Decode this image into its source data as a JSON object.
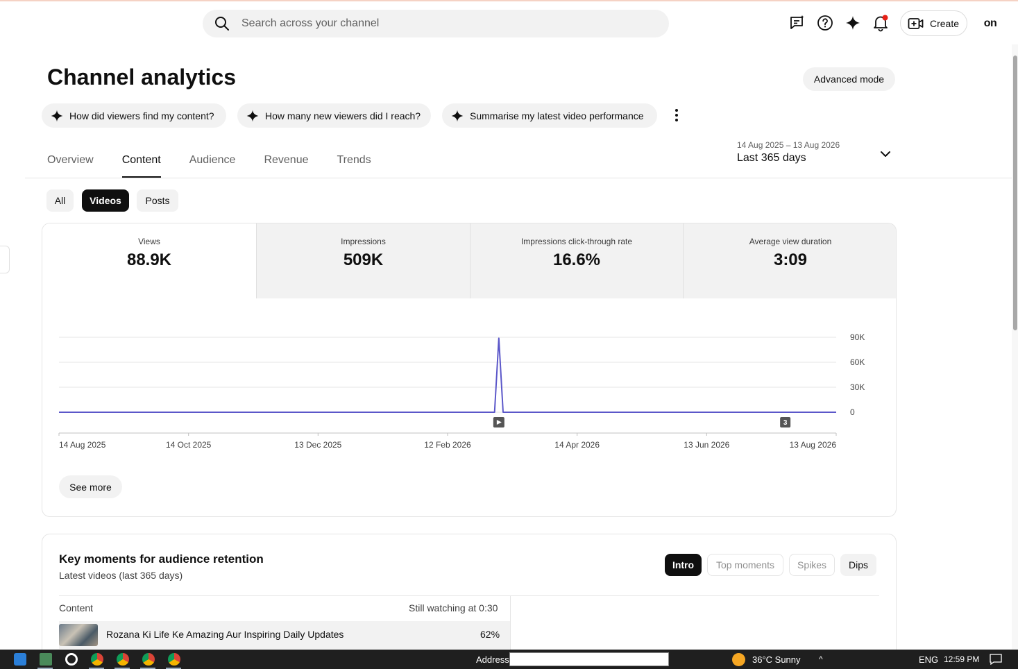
{
  "header": {
    "search_placeholder": "Search across your channel",
    "create_label": "Create",
    "avatar_text": "on",
    "icons": [
      "feedback-icon",
      "help-icon",
      "sparkle-icon",
      "notifications-icon",
      "create-video-icon"
    ]
  },
  "page": {
    "title": "Channel analytics",
    "advanced_mode_label": "Advanced mode"
  },
  "ai_chips": [
    {
      "label": "How did viewers find my content?"
    },
    {
      "label": "How many new viewers did I reach?"
    },
    {
      "label": "Summarise my latest video performance"
    }
  ],
  "tabs": [
    {
      "label": "Overview",
      "active": false
    },
    {
      "label": "Content",
      "active": true
    },
    {
      "label": "Audience",
      "active": false
    },
    {
      "label": "Revenue",
      "active": false
    },
    {
      "label": "Trends",
      "active": false
    }
  ],
  "date_range": {
    "dates": "14 Aug 2025 – 13 Aug 2026",
    "label": "Last 365 days"
  },
  "filters": [
    {
      "label": "All",
      "active": false
    },
    {
      "label": "Videos",
      "active": true
    },
    {
      "label": "Posts",
      "active": false
    }
  ],
  "metrics": [
    {
      "label": "Views",
      "value": "88.9K",
      "active": true
    },
    {
      "label": "Impressions",
      "value": "509K",
      "active": false
    },
    {
      "label": "Impressions click-through rate",
      "value": "16.6%",
      "active": false
    },
    {
      "label": "Average view duration",
      "value": "3:09",
      "active": false
    }
  ],
  "chart_data": {
    "type": "line",
    "series": [
      {
        "color": "#5b57c9",
        "points": [
          [
            "2025-08-14",
            0
          ],
          [
            "2026-03-06",
            0
          ],
          [
            "2026-03-08",
            88900
          ],
          [
            "2026-03-10",
            0
          ],
          [
            "2026-08-13",
            0
          ]
        ]
      }
    ],
    "x_ticks": [
      "14 Aug 2025",
      "14 Oct 2025",
      "13 Dec 2025",
      "12 Feb 2026",
      "14 Apr 2026",
      "13 Jun 2026",
      "13 Aug 2026"
    ],
    "y_ticks": [
      "0",
      "30K",
      "60K",
      "90K"
    ],
    "ylim": [
      0,
      90000
    ],
    "xlim": [
      "2025-08-14",
      "2026-08-13"
    ],
    "grid": true,
    "markers": [
      {
        "date": "2026-03-08",
        "kind": "video-publish-icon",
        "text": ""
      },
      {
        "date": "2026-07-20",
        "kind": "count-badge",
        "text": "3"
      }
    ]
  },
  "see_more_label": "See more",
  "key_moments": {
    "title": "Key moments for audience retention",
    "subtitle": "Latest videos (last 365 days)",
    "segments": [
      {
        "label": "Intro",
        "state": "active"
      },
      {
        "label": "Top moments",
        "state": "disabled"
      },
      {
        "label": "Spikes",
        "state": "disabled"
      },
      {
        "label": "Dips",
        "state": "normal"
      }
    ],
    "table": {
      "headers": [
        "Content",
        "Still watching at 0:30"
      ],
      "rows": [
        {
          "title": "Rozana Ki Life Ke Amazing Aur Inspiring Daily Updates",
          "value": "62%"
        }
      ]
    }
  },
  "taskbar": {
    "address_label": "Address",
    "weather": "36°C  Sunny",
    "language": "ENG",
    "time": "12:59 PM"
  }
}
